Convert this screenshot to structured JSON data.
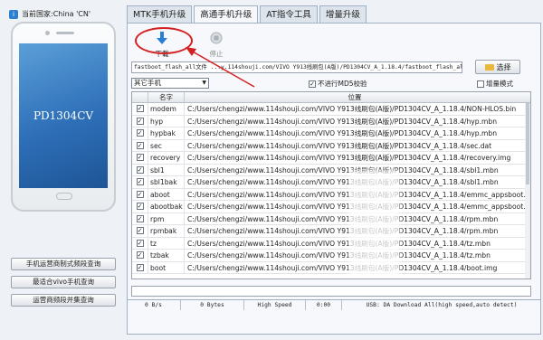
{
  "country_label": "当前国家:China 'CN'",
  "phone_model": "PD1304CV",
  "tabs": [
    "MTK手机升级",
    "高通手机升级",
    "AT指令工具",
    "增量升级"
  ],
  "toolbar": {
    "download": "下载",
    "stop": "停止"
  },
  "file_path": "fastboot_flash_all文件 ...y.114shouji.com/VIVO Y913线刷包(A版)/PD1304CV_A_1.18.4/fastboot_flash_all.bat",
  "select_button": "选择",
  "model_combo": "其它手机",
  "no_md5_label": "不进行MD5校验",
  "increment_mode_label": "增量模式",
  "table": {
    "headers": [
      "名字",
      "位置"
    ],
    "rows": [
      {
        "name": "modem",
        "path": "C:/Users/chengzi/www.114shouji.com/VIVO Y913线刷包(A版)/PD1304CV_A_1.18.4/NON-HLOS.bin"
      },
      {
        "name": "hyp",
        "path": "C:/Users/chengzi/www.114shouji.com/VIVO Y913线刷包(A版)/PD1304CV_A_1.18.4/hyp.mbn"
      },
      {
        "name": "hypbak",
        "path": "C:/Users/chengzi/www.114shouji.com/VIVO Y913线刷包(A版)/PD1304CV_A_1.18.4/hyp.mbn"
      },
      {
        "name": "sec",
        "path": "C:/Users/chengzi/www.114shouji.com/VIVO Y913线刷包(A版)/PD1304CV_A_1.18.4/sec.dat"
      },
      {
        "name": "recovery",
        "path": "C:/Users/chengzi/www.114shouji.com/VIVO Y913线刷包(A版)/PD1304CV_A_1.18.4/recovery.img"
      },
      {
        "name": "sbl1",
        "path": "C:/Users/chengzi/www.114shouji.com/VIVO Y913线刷包(A版)/PD1304CV_A_1.18.4/sbl1.mbn"
      },
      {
        "name": "sbl1bak",
        "path": "C:/Users/chengzi/www.114shouji.com/VIVO Y913线刷包(A版)/PD1304CV_A_1.18.4/sbl1.mbn"
      },
      {
        "name": "aboot",
        "path": "C:/Users/chengzi/www.114shouji.com/VIVO Y913线刷包(A版)/PD1304CV_A_1.18.4/emmc_appsboot.mbn"
      },
      {
        "name": "abootbak",
        "path": "C:/Users/chengzi/www.114shouji.com/VIVO Y913线刷包(A版)/PD1304CV_A_1.18.4/emmc_appsboot.mbn"
      },
      {
        "name": "rpm",
        "path": "C:/Users/chengzi/www.114shouji.com/VIVO Y913线刷包(A版)/PD1304CV_A_1.18.4/rpm.mbn"
      },
      {
        "name": "rpmbak",
        "path": "C:/Users/chengzi/www.114shouji.com/VIVO Y913线刷包(A版)/PD1304CV_A_1.18.4/rpm.mbn"
      },
      {
        "name": "tz",
        "path": "C:/Users/chengzi/www.114shouji.com/VIVO Y913线刷包(A版)/PD1304CV_A_1.18.4/tz.mbn"
      },
      {
        "name": "tzbak",
        "path": "C:/Users/chengzi/www.114shouji.com/VIVO Y913线刷包(A版)/PD1304CV_A_1.18.4/tz.mbn"
      },
      {
        "name": "boot",
        "path": "C:/Users/chengzi/www.114shouji.com/VIVO Y913线刷包(A版)/PD1304CV_A_1.18.4/boot.img"
      }
    ]
  },
  "left_buttons": [
    "手机运营商制式频段查询",
    "最适合vivo手机查询",
    "运营商频段并集查询"
  ],
  "status": {
    "speed": "0 B/s",
    "bytes": "0 Bytes",
    "mode": "High Speed",
    "time": "0:00",
    "usb": "USB: DA Download All(high speed,auto detect)"
  },
  "colors": {
    "tab_border": "#9fb1c7",
    "annotation": "#d42020",
    "download_icon": "#2a7fd4"
  },
  "icons": {
    "download": "download-arrow-icon",
    "stop": "stop-icon",
    "select": "folder-icon"
  }
}
